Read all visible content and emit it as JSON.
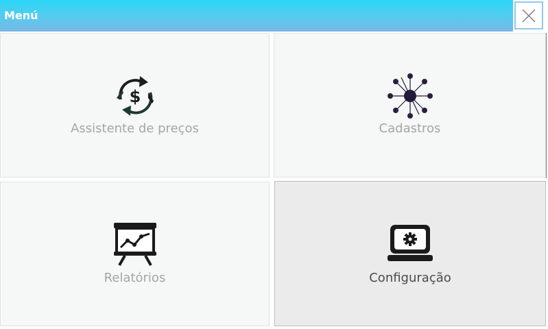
{
  "window": {
    "title": "Menú"
  },
  "menu": {
    "tiles": [
      {
        "label": "Assistente de preços",
        "icon": "dollar-cycle-icon"
      },
      {
        "label": "Cadastros",
        "icon": "network-hub-icon"
      },
      {
        "label": "Relatórios",
        "icon": "presentation-chart-icon"
      },
      {
        "label": "Configuração",
        "icon": "laptop-gear-icon"
      }
    ]
  },
  "colors": {
    "titlebar_top": "#2bd6f7",
    "titlebar_bottom": "#7bb8e6",
    "tile_bg": "#f6f7f7",
    "tile_active_bg": "#ebebeb",
    "label_muted": "#a3a5a7",
    "label_active": "#4a4a4a"
  }
}
